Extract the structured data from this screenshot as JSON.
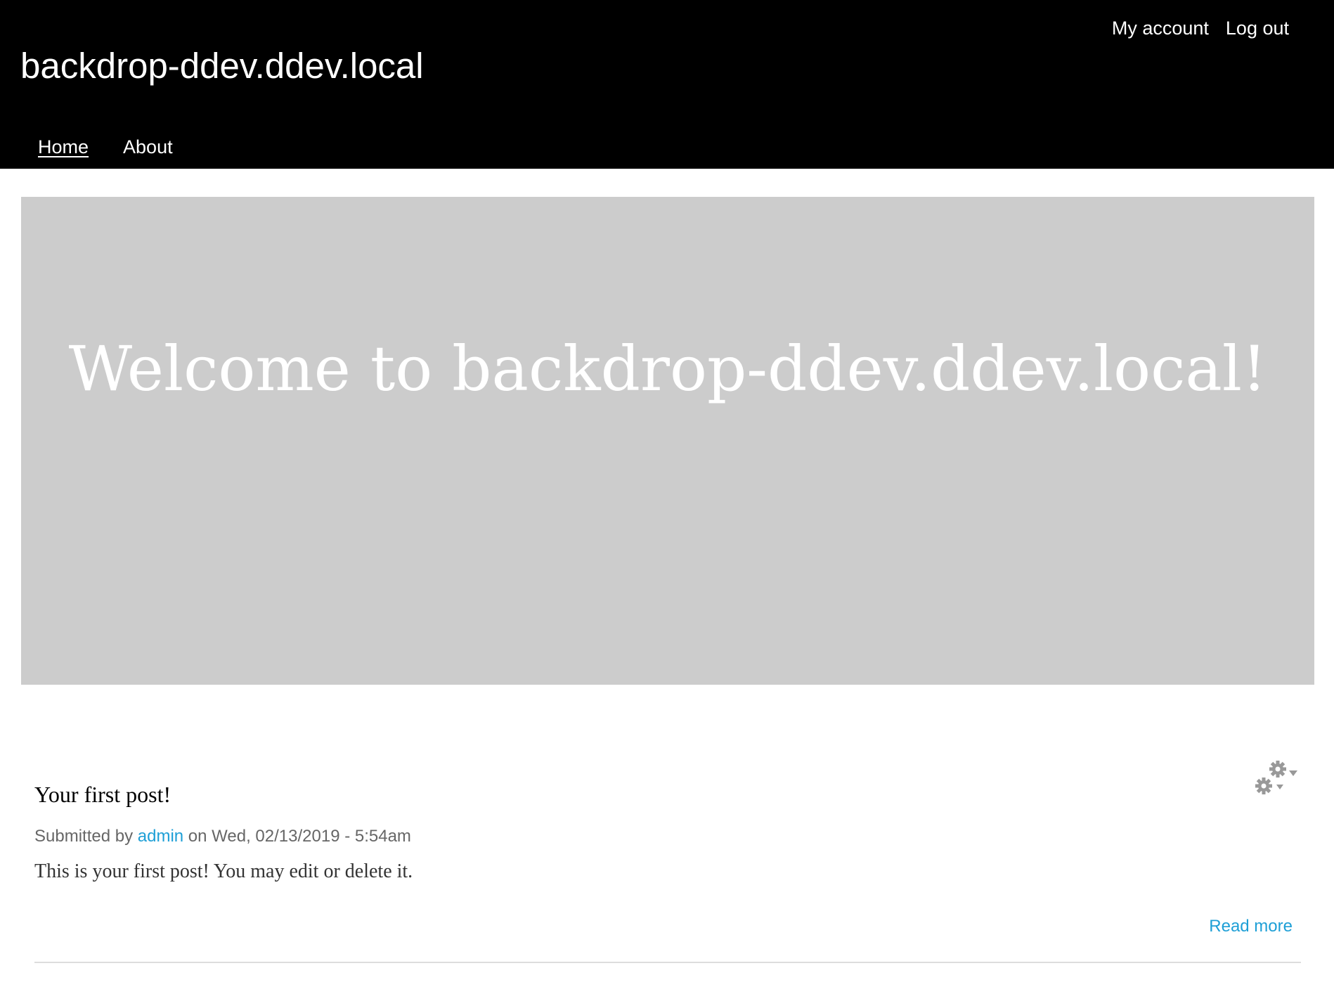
{
  "header": {
    "site_name": "backdrop-ddev.ddev.local",
    "account_menu": [
      {
        "label": "My account"
      },
      {
        "label": "Log out"
      }
    ],
    "main_menu": [
      {
        "label": "Home",
        "active": true
      },
      {
        "label": "About",
        "active": false
      }
    ]
  },
  "hero": {
    "title": "Welcome to backdrop-ddev.ddev.local!",
    "background_color": "#cccccc"
  },
  "post": {
    "title": "Your first post!",
    "submitted_prefix": "Submitted by",
    "author": "admin",
    "submitted_middle": "on",
    "date": "Wed, 02/13/2019 - 5:54am",
    "body": "This is your first post! You may edit or delete it.",
    "read_more": "Read more",
    "contextual_links_icon": "gear-icon"
  },
  "colors": {
    "header_background": "#000000",
    "link": "#1e9fd6",
    "meta_text": "#666666"
  }
}
